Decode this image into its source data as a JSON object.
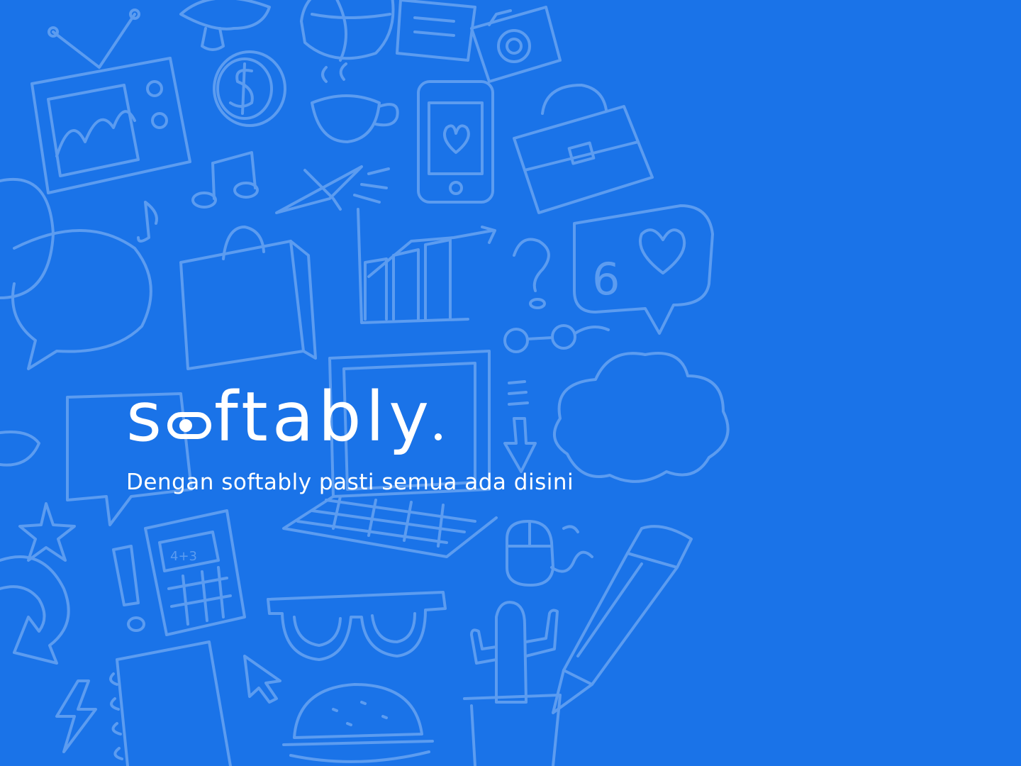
{
  "brand": {
    "logo_start": "s",
    "logo_end": "ftably",
    "tagline": "Dengan softably pasti semua ada disini"
  },
  "colors": {
    "background": "#1a73e8",
    "doodle": "#5c9cf0",
    "text": "#ffffff"
  },
  "doodles": [
    "tv-icon",
    "mushroom-icon",
    "coin-dollar-icon",
    "ball-icon",
    "notebook-icon",
    "camera-icon",
    "coffee-cup-icon",
    "smartphone-icon",
    "briefcase-icon",
    "music-note-icon",
    "paper-plane-icon",
    "shopping-bag-icon",
    "bar-chart-icon",
    "question-mark-icon",
    "heart-bubble-icon",
    "speech-bubble-icon",
    "laptop-icon",
    "cloud-icon",
    "star-icon",
    "calculator-icon",
    "exclamation-icon",
    "glasses-icon",
    "mouse-icon",
    "pencil-icon",
    "arrow-icon",
    "lightning-icon",
    "spiral-notebook-icon",
    "cursor-icon",
    "burger-icon",
    "cactus-icon",
    "eyeglasses-icon"
  ]
}
